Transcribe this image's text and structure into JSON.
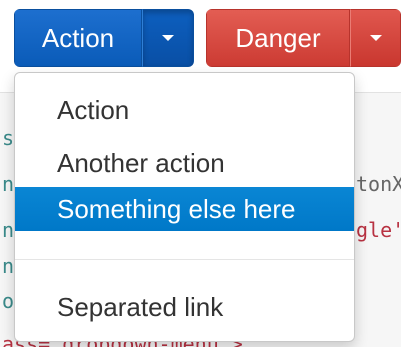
{
  "buttons": {
    "primary_label": "Action",
    "danger_label": "Danger"
  },
  "dropdown": {
    "items": [
      {
        "label": "Action"
      },
      {
        "label": "Another action"
      },
      {
        "label": "Something else here"
      },
      {
        "label": "Separated link"
      }
    ],
    "active_item": "Something else here"
  },
  "code_fragments": {
    "left": [
      "s",
      "n",
      "n",
      "n",
      "o"
    ],
    "right_line_1": "tonX",
    "right_line_2": "gle'",
    "bottom_line": "ass=\"dropdown-menu\">"
  },
  "colors": {
    "primary": "#0a5bb8",
    "danger": "#cc3b33",
    "active_item_bg": "#0078c8",
    "code_teal": "#3a8a8a",
    "code_red": "#b83242"
  }
}
